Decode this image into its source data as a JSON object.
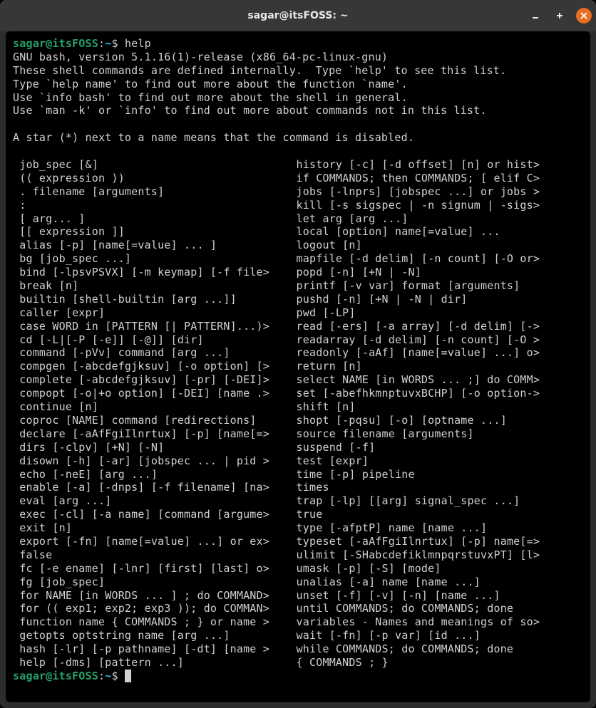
{
  "window": {
    "title": "sagar@itsFOSS: ~"
  },
  "prompt": {
    "user_host": "sagar@itsFOSS",
    "path": "~",
    "separator": ":",
    "dollar": "$"
  },
  "command": "help",
  "intro": {
    "line1": "GNU bash, version 5.1.16(1)-release (x86_64-pc-linux-gnu)",
    "line2": "These shell commands are defined internally.  Type `help' to see this list.",
    "line3": "Type `help name' to find out more about the function `name'.",
    "line4": "Use `info bash' to find out more about the shell in general.",
    "line5": "Use `man -k' or `info' to find out more about commands not in this list.",
    "line6": "A star (*) next to a name means that the command is disabled."
  },
  "builtins": {
    "left": [
      "job_spec [&]",
      "(( expression ))",
      ". filename [arguments]",
      ":",
      "[ arg... ]",
      "[[ expression ]]",
      "alias [-p] [name[=value] ... ]",
      "bg [job_spec ...]",
      "bind [-lpsvPSVX] [-m keymap] [-f file>",
      "break [n]",
      "builtin [shell-builtin [arg ...]]",
      "caller [expr]",
      "case WORD in [PATTERN [| PATTERN]...)>",
      "cd [-L|[-P [-e]] [-@]] [dir]",
      "command [-pVv] command [arg ...]",
      "compgen [-abcdefgjksuv] [-o option] [>",
      "complete [-abcdefgjksuv] [-pr] [-DEI]>",
      "compopt [-o|+o option] [-DEI] [name .>",
      "continue [n]",
      "coproc [NAME] command [redirections]",
      "declare [-aAfFgiIlnrtux] [-p] [name[=>",
      "dirs [-clpv] [+N] [-N]",
      "disown [-h] [-ar] [jobspec ... | pid >",
      "echo [-neE] [arg ...]",
      "enable [-a] [-dnps] [-f filename] [na>",
      "eval [arg ...]",
      "exec [-cl] [-a name] [command [argume>",
      "exit [n]",
      "export [-fn] [name[=value] ...] or ex>",
      "false",
      "fc [-e ename] [-lnr] [first] [last] o>",
      "fg [job_spec]",
      "for NAME [in WORDS ... ] ; do COMMAND>",
      "for (( exp1; exp2; exp3 )); do COMMAN>",
      "function name { COMMANDS ; } or name >",
      "getopts optstring name [arg ...]",
      "hash [-lr] [-p pathname] [-dt] [name >",
      "help [-dms] [pattern ...]"
    ],
    "right": [
      "history [-c] [-d offset] [n] or hist>",
      "if COMMANDS; then COMMANDS; [ elif C>",
      "jobs [-lnprs] [jobspec ...] or jobs >",
      "kill [-s sigspec | -n signum | -sigs>",
      "let arg [arg ...]",
      "local [option] name[=value] ...",
      "logout [n]",
      "mapfile [-d delim] [-n count] [-O or>",
      "popd [-n] [+N | -N]",
      "printf [-v var] format [arguments]",
      "pushd [-n] [+N | -N | dir]",
      "pwd [-LP]",
      "read [-ers] [-a array] [-d delim] [->",
      "readarray [-d delim] [-n count] [-O >",
      "readonly [-aAf] [name[=value] ...] o>",
      "return [n]",
      "select NAME [in WORDS ... ;] do COMM>",
      "set [-abefhkmnptuvxBCHP] [-o option->",
      "shift [n]",
      "shopt [-pqsu] [-o] [optname ...]",
      "source filename [arguments]",
      "suspend [-f]",
      "test [expr]",
      "time [-p] pipeline",
      "times",
      "trap [-lp] [[arg] signal_spec ...]",
      "true",
      "type [-afptP] name [name ...]",
      "typeset [-aAfFgiIlnrtux] [-p] name[=>",
      "ulimit [-SHabcdefiklmnpqrstuvxPT] [l>",
      "umask [-p] [-S] [mode]",
      "unalias [-a] name [name ...]",
      "unset [-f] [-v] [-n] [name ...]",
      "until COMMANDS; do COMMANDS; done",
      "variables - Names and meanings of so>",
      "wait [-fn] [-p var] [id ...]",
      "while COMMANDS; do COMMANDS; done",
      "{ COMMANDS ; }"
    ]
  }
}
